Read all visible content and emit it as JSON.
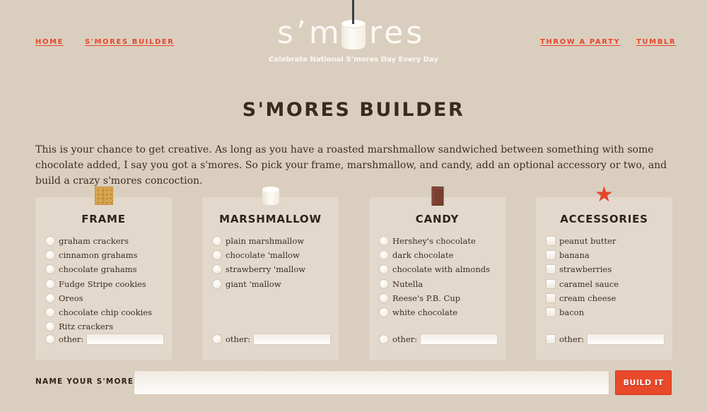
{
  "nav": {
    "left": [
      {
        "label": "HOME"
      },
      {
        "label": "S'MORES BUILDER"
      }
    ],
    "right": [
      {
        "label": "THROW A PARTY"
      },
      {
        "label": "TUMBLR"
      }
    ]
  },
  "logo": {
    "text_left": "s’m",
    "text_right": "res",
    "tagline": "Celebrate National S’mores Day Every Day"
  },
  "page": {
    "title": "S'MORES BUILDER",
    "intro": "This is your chance to get creative. As long as you have a roasted marshmallow sandwiched between something with some chocolate added, I say you got a s'mores. So pick your frame, marshmallow, and candy, add an optional accessory or two, and build a crazy s'mores concoction."
  },
  "panels": [
    {
      "title": "FRAME",
      "icon": "graham-cracker-icon",
      "input_type": "radio",
      "options": [
        "graham crackers",
        "cinnamon grahams",
        "chocolate grahams",
        "Fudge Stripe cookies",
        "Oreos",
        "chocolate chip cookies",
        "Ritz crackers"
      ],
      "other_label": "other:",
      "other_value": ""
    },
    {
      "title": "MARSHMALLOW",
      "icon": "marshmallow-icon",
      "input_type": "radio",
      "options": [
        "plain marshmallow",
        "chocolate 'mallow",
        "strawberry 'mallow",
        "giant 'mallow"
      ],
      "other_label": "other:",
      "other_value": ""
    },
    {
      "title": "CANDY",
      "icon": "chocolate-bar-icon",
      "input_type": "radio",
      "options": [
        "Hershey's chocolate",
        "dark chocolate",
        "chocolate with almonds",
        "Nutella",
        "Reese's P.B. Cup",
        "white chocolate"
      ],
      "other_label": "other:",
      "other_value": ""
    },
    {
      "title": "ACCESSORIES",
      "icon": "star-icon",
      "icon_glyph": "★",
      "input_type": "checkbox",
      "options": [
        "peanut butter",
        "banana",
        "strawberries",
        "caramel sauce",
        "cream cheese",
        "bacon"
      ],
      "other_label": "other:",
      "other_value": ""
    }
  ],
  "name_form": {
    "label": "NAME YOUR S'MORES:",
    "value": "",
    "button_label": "BUILD IT"
  },
  "colors": {
    "background": "#dacfbf",
    "accent": "#e8492b",
    "panel": "#e2d8cb",
    "text": "#3a2e26"
  }
}
